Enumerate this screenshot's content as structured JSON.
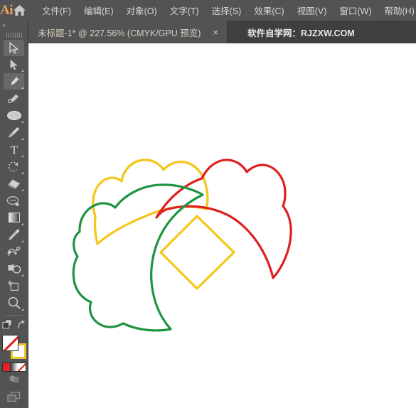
{
  "app": {
    "name": "Adobe Illustrator",
    "logo_text": "Ai",
    "home_icon": "home-icon"
  },
  "menubar": {
    "items": [
      {
        "label": "文件(F)",
        "name": "menu-file"
      },
      {
        "label": "编辑(E)",
        "name": "menu-edit"
      },
      {
        "label": "对象(O)",
        "name": "menu-object"
      },
      {
        "label": "文字(T)",
        "name": "menu-type"
      },
      {
        "label": "选择(S)",
        "name": "menu-select"
      },
      {
        "label": "效果(C)",
        "name": "menu-effect"
      },
      {
        "label": "视图(V)",
        "name": "menu-view"
      },
      {
        "label": "窗口(W)",
        "name": "menu-window"
      },
      {
        "label": "帮助(H)",
        "name": "menu-help"
      }
    ]
  },
  "tabbar": {
    "document_tab": {
      "title": "未标题-1* @ 227.56% (CMYK/GPU 预览)",
      "close_label": "×",
      "doc_name": "未标题-1*",
      "zoom": "227.56%",
      "color_mode": "CMYK/GPU 预览"
    },
    "watermark": "软件自学网：RJZXW.COM"
  },
  "toolpanel": {
    "collapse_label": "»",
    "tools": [
      {
        "name": "selection-tool",
        "label": "选择工具",
        "active": true,
        "flyout": false
      },
      {
        "name": "direct-selection-tool",
        "label": "直接选择工具",
        "active": false,
        "flyout": true
      },
      {
        "name": "pen-tool",
        "label": "钢笔工具",
        "active": true,
        "flyout": true
      },
      {
        "name": "curvature-tool",
        "label": "曲率工具",
        "active": false,
        "flyout": false
      },
      {
        "name": "ellipse-tool",
        "label": "椭圆工具",
        "active": false,
        "flyout": true
      },
      {
        "name": "paintbrush-tool",
        "label": "画笔工具",
        "active": false,
        "flyout": true
      },
      {
        "name": "type-tool",
        "label": "文字工具",
        "active": false,
        "flyout": true
      },
      {
        "name": "rotate-tool",
        "label": "旋转工具",
        "active": false,
        "flyout": true
      },
      {
        "name": "eraser-tool",
        "label": "橡皮擦工具",
        "active": false,
        "flyout": true
      },
      {
        "name": "shaper-tool",
        "label": "选择套索工具",
        "active": false,
        "flyout": false
      },
      {
        "name": "gradient-tool",
        "label": "渐变工具",
        "active": false,
        "flyout": true
      },
      {
        "name": "eyedropper-tool",
        "label": "吸管工具",
        "active": false,
        "flyout": true
      },
      {
        "name": "blend-tool",
        "label": "混合工具",
        "active": false,
        "flyout": false
      },
      {
        "name": "shape-builder-tool",
        "label": "形状生成器工具",
        "active": false,
        "flyout": true
      },
      {
        "name": "artboard-tool",
        "label": "画板工具",
        "active": false,
        "flyout": false
      },
      {
        "name": "zoom-tool",
        "label": "缩放工具",
        "active": false,
        "flyout": true
      }
    ],
    "edit_toolbar_label": "编辑工具栏",
    "swap_label": "互换填色和描边",
    "fill_color": "none",
    "stroke_color": "#F2C12E",
    "color_modes": [
      "颜色",
      "渐变",
      "无"
    ],
    "draw_mode_label": "绘图模式",
    "screen_mode_label": "更改屏幕模式"
  },
  "artwork": {
    "title": "三色云纹图形",
    "colors": {
      "yellow": "#F5C518",
      "red": "#E02020",
      "green": "#1E9440",
      "canvas": "#FFFFFF"
    },
    "shapes": [
      {
        "name": "yellow-cloud-path",
        "color": "#F5C518",
        "stroke_width": 3
      },
      {
        "name": "red-cloud-path",
        "color": "#E02020",
        "stroke_width": 3
      },
      {
        "name": "green-cloud-path",
        "color": "#1E9440",
        "stroke_width": 3
      },
      {
        "name": "yellow-diamond-path",
        "color": "#F5C518",
        "stroke_width": 3
      }
    ]
  }
}
